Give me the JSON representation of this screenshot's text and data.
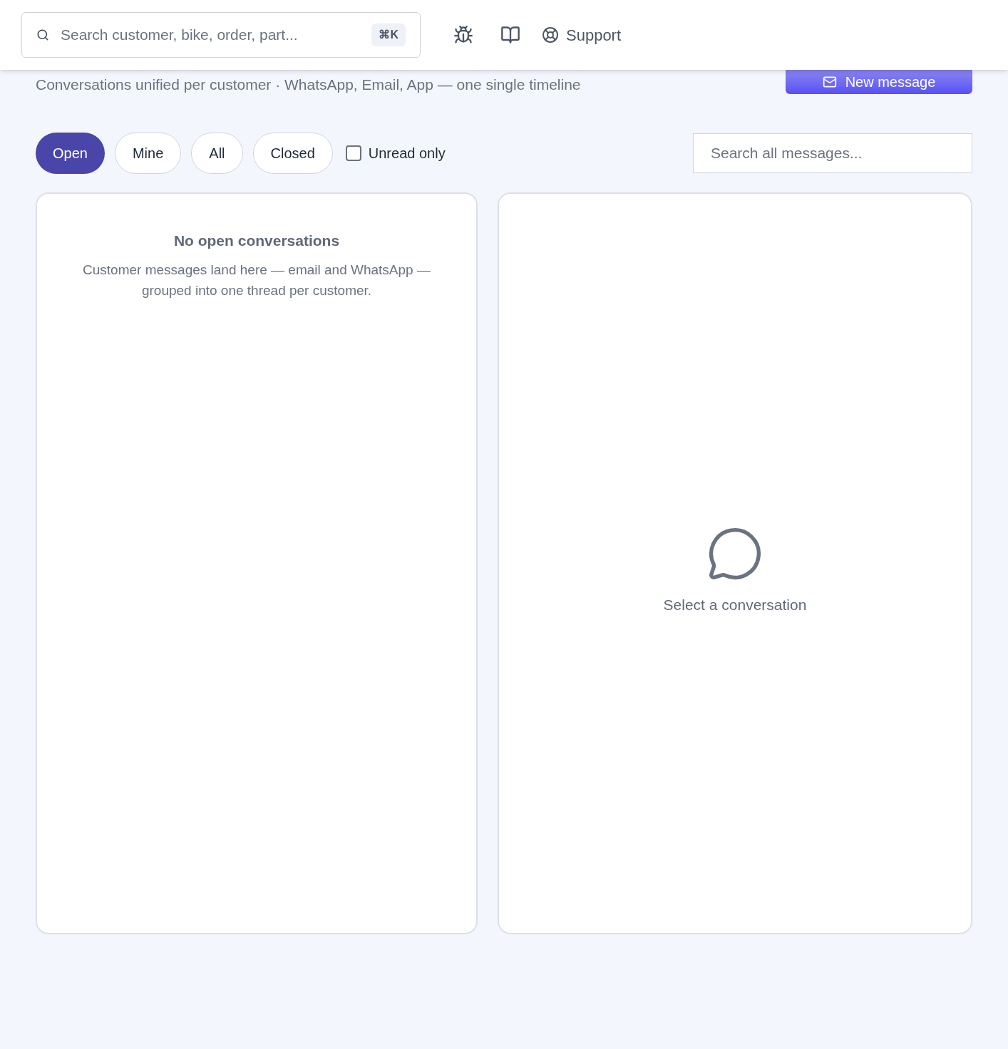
{
  "header": {
    "search": {
      "placeholder": "Search customer, bike, order, part...",
      "shortcut": "⌘K"
    },
    "support_label": "Support"
  },
  "page": {
    "subtitle": "Conversations unified per customer · WhatsApp, Email, App — one single timeline",
    "new_button": "New message"
  },
  "filters": [
    {
      "label": "Open",
      "selected": true
    },
    {
      "label": "Mine",
      "selected": false
    },
    {
      "label": "All",
      "selected": false
    },
    {
      "label": "Closed",
      "selected": false
    }
  ],
  "unread_only": {
    "label": "Unread only",
    "checked": false
  },
  "message_search": {
    "placeholder": "Search all messages..."
  },
  "list_panel": {
    "title": "No open conversations",
    "text": "Customer messages land here — email and WhatsApp — grouped into one thread per customer."
  },
  "detail_panel": {
    "text": "Select a conversation"
  }
}
